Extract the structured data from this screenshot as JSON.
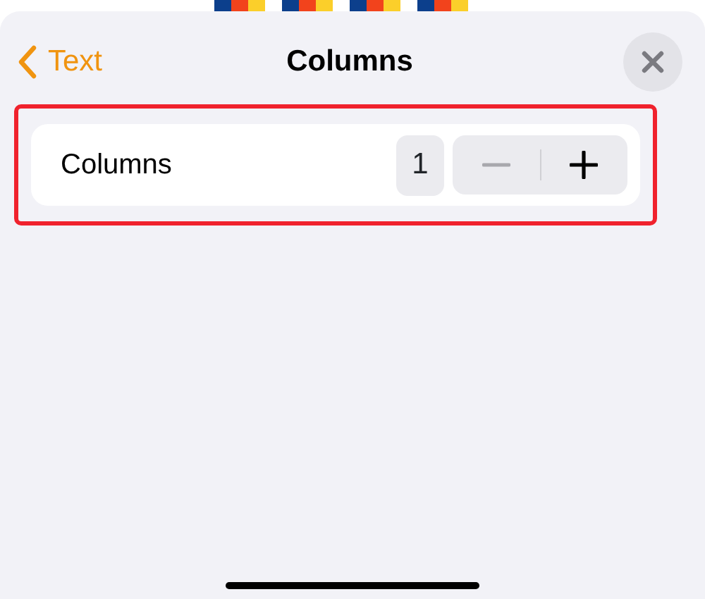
{
  "header": {
    "back_label": "Text",
    "title": "Columns"
  },
  "rows": [
    {
      "label": "Columns",
      "value": "1",
      "highlighted": true,
      "decrement_disabled": true,
      "increment_disabled": false
    }
  ]
}
